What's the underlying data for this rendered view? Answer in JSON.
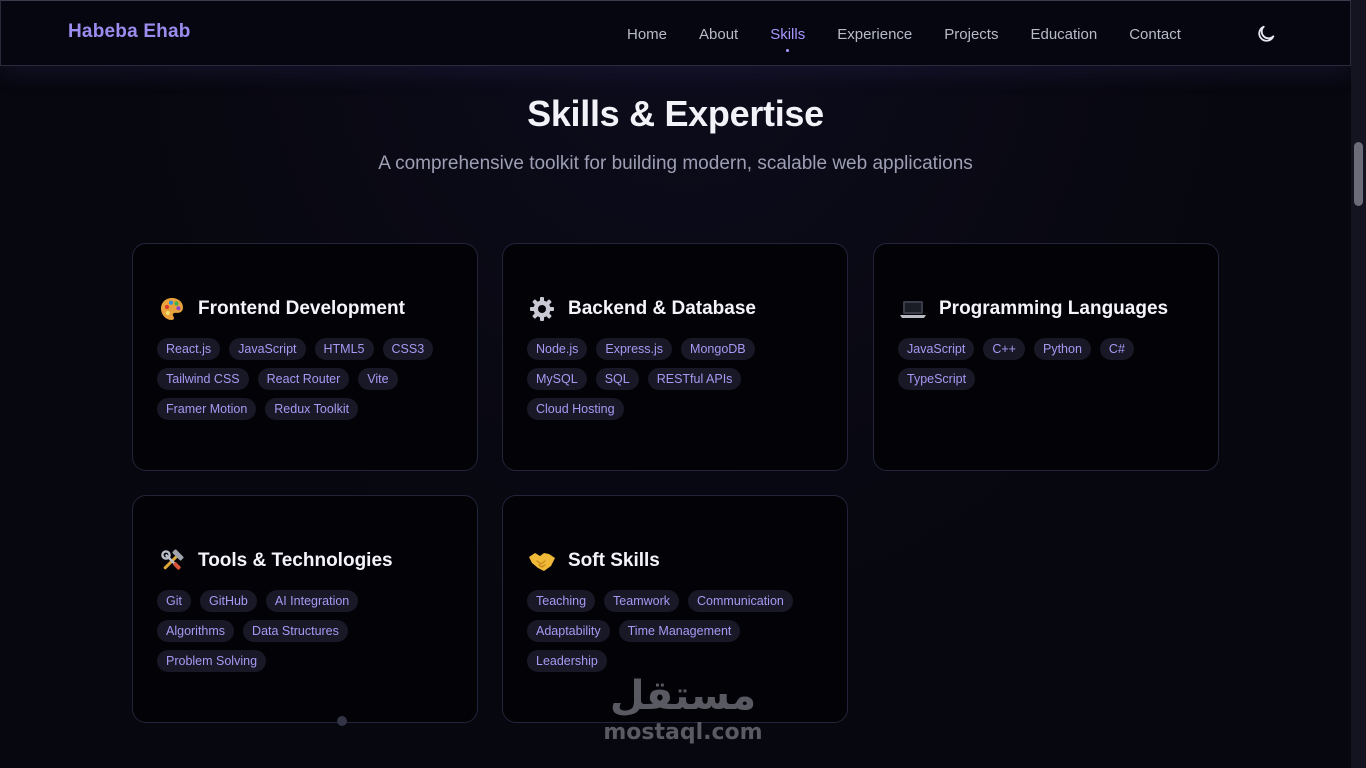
{
  "brand": "Habeba Ehab",
  "nav": {
    "items": [
      {
        "label": "Home"
      },
      {
        "label": "About"
      },
      {
        "label": "Skills",
        "active": true
      },
      {
        "label": "Experience"
      },
      {
        "label": "Projects"
      },
      {
        "label": "Education"
      },
      {
        "label": "Contact"
      }
    ],
    "theme_toggle_icon": "moon-icon"
  },
  "section": {
    "title": "Skills & Expertise",
    "subtitle": "A comprehensive toolkit for building modern, scalable web applications"
  },
  "cards": [
    {
      "icon": "palette-icon",
      "title": "Frontend Development",
      "skills": [
        "React.js",
        "JavaScript",
        "HTML5",
        "CSS3",
        "Tailwind CSS",
        "React Router",
        "Vite",
        "Framer Motion",
        "Redux Toolkit"
      ]
    },
    {
      "icon": "gear-icon",
      "title": "Backend & Database",
      "skills": [
        "Node.js",
        "Express.js",
        "MongoDB",
        "MySQL",
        "SQL",
        "RESTful APIs",
        "Cloud Hosting"
      ]
    },
    {
      "icon": "laptop-icon",
      "title": "Programming Languages",
      "skills": [
        "JavaScript",
        "C++",
        "Python",
        "C#",
        "TypeScript"
      ]
    },
    {
      "icon": "tools-icon",
      "title": "Tools & Technologies",
      "skills": [
        "Git",
        "GitHub",
        "AI Integration",
        "Algorithms",
        "Data Structures",
        "Problem Solving"
      ]
    },
    {
      "icon": "handshake-icon",
      "title": "Soft Skills",
      "skills": [
        "Teaching",
        "Teamwork",
        "Communication",
        "Adaptability",
        "Time Management",
        "Leadership"
      ]
    }
  ],
  "watermark": {
    "arabic": "مستقل",
    "latin": "mostaql.com"
  },
  "colors": {
    "accent": "#a996ff",
    "brand": "#9d8cf0",
    "chip_bg": "#181827",
    "card_bg": "#030307"
  }
}
